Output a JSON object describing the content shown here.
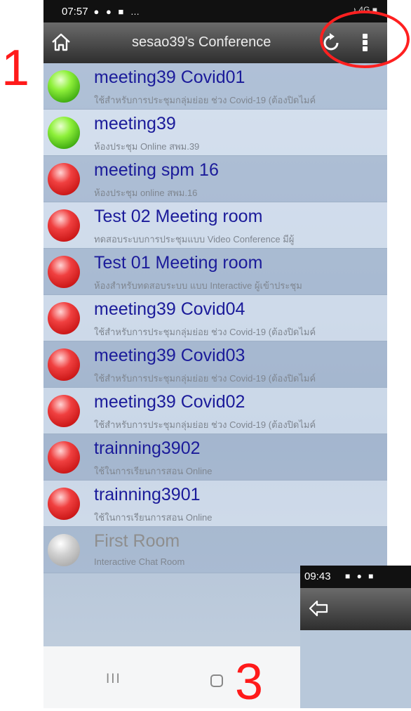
{
  "status": {
    "time": "07:57",
    "icons": "● ● ■ …",
    "right": "♪ 4G ■"
  },
  "appbar": {
    "title": "sesao39's Conference"
  },
  "rooms": [
    {
      "name": "meeting39 Covid01",
      "desc": "ใช้สำหรับการประชุมกลุ่มย่อย ช่วง Covid-19 (ต้องปิดไมค์",
      "status": "green"
    },
    {
      "name": "meeting39",
      "desc": "ห้องประชุม Online สพม.39",
      "status": "green"
    },
    {
      "name": "meeting spm 16",
      "desc": "ห้องประชุม online สพม.16",
      "status": "red"
    },
    {
      "name": "Test 02 Meeting room",
      "desc": "ทดสอบระบบการประชุมแบบ Video Conference มีผู้",
      "status": "red"
    },
    {
      "name": "Test 01 Meeting room",
      "desc": "ห้องสำหรับทดสอบระบบ แบบ Interactive ผู้เข้าประชุม",
      "status": "red"
    },
    {
      "name": "meeting39 Covid04",
      "desc": "ใช้สำหรับการประชุมกลุ่มย่อย ช่วง Covid-19 (ต้องปิดไมค์",
      "status": "red"
    },
    {
      "name": "meeting39 Covid03",
      "desc": "ใช้สำหรับการประชุมกลุ่มย่อย ช่วง Covid-19 (ต้องปิดไมค์",
      "status": "red"
    },
    {
      "name": "meeting39 Covid02",
      "desc": "ใช้สำหรับการประชุมกลุ่มย่อย ช่วง Covid-19 (ต้องปิดไมค์",
      "status": "red"
    },
    {
      "name": "trainning3902",
      "desc": "ใช้ในการเรียนการสอน Online",
      "status": "red"
    },
    {
      "name": "trainning3901",
      "desc": "ใช้ในการเรียนการสอน Online",
      "status": "red"
    },
    {
      "name": "First Room",
      "desc": "Interactive Chat Room",
      "status": "gray"
    }
  ],
  "navbar": {
    "recents": "III"
  },
  "annotations": {
    "one": "1",
    "three": "3"
  },
  "inset": {
    "time": "09:43",
    "icons": "■ ● ■"
  },
  "colors": {
    "accent": "#ff1a1a",
    "room_name": "#1b1b9a"
  }
}
